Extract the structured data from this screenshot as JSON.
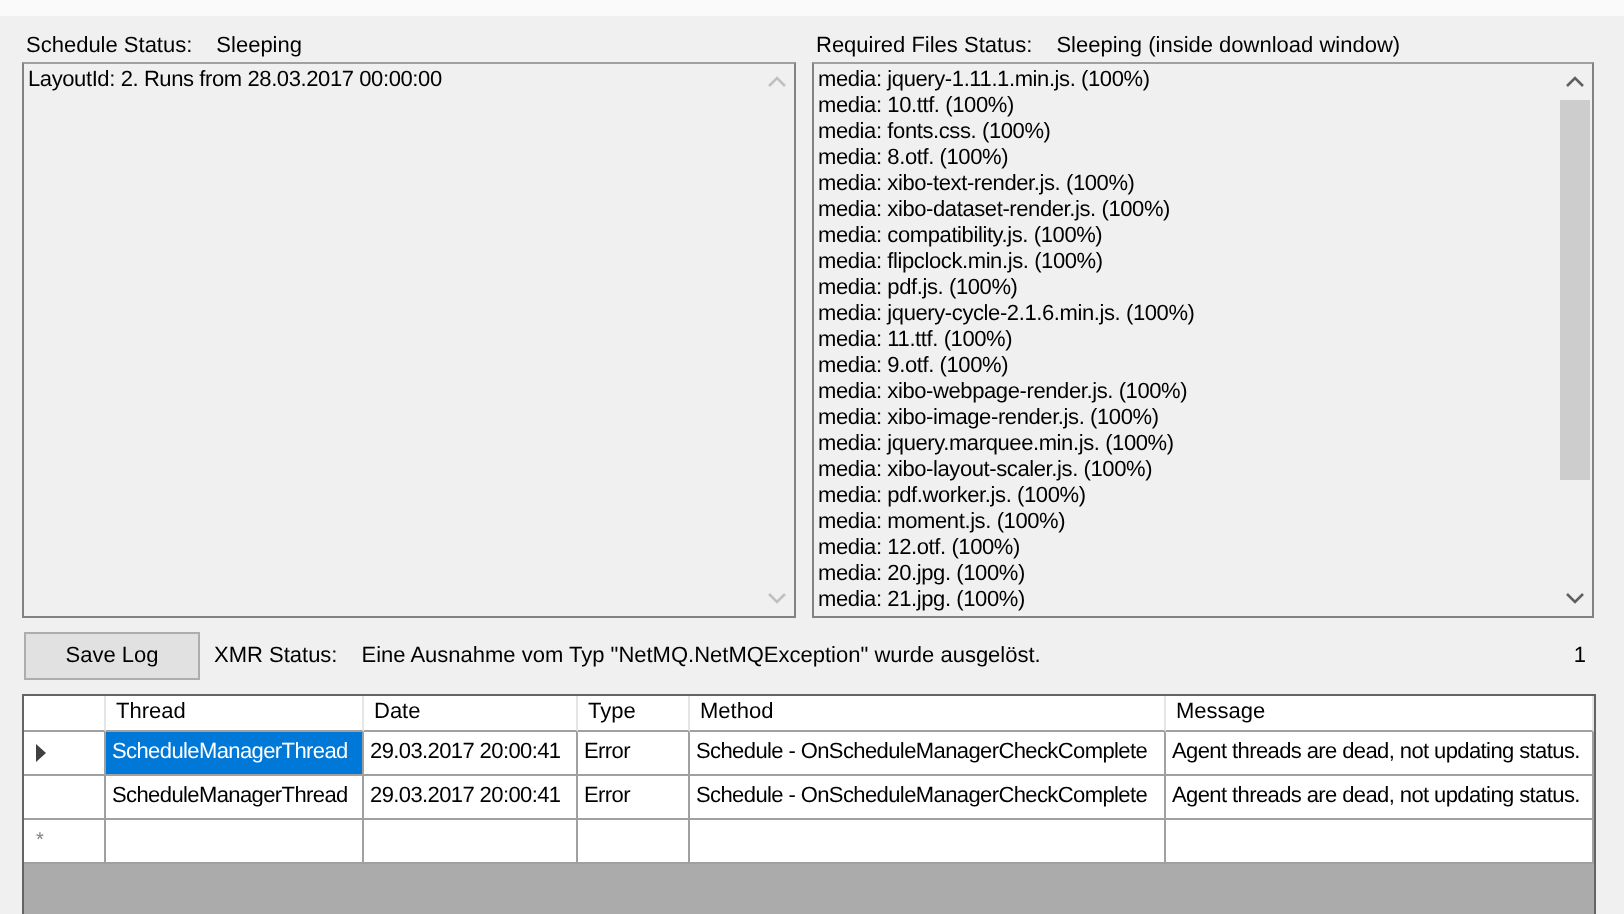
{
  "schedule_status": {
    "label": "Schedule Status:",
    "value": "Sleeping",
    "lines": [
      "LayoutId: 2. Runs from 28.03.2017 00:00:00"
    ]
  },
  "required_files_status": {
    "label": "Required Files Status:",
    "value": "Sleeping (inside download window)",
    "lines": [
      "media: jquery-1.11.1.min.js. (100%)",
      "media: 10.ttf. (100%)",
      "media: fonts.css. (100%)",
      "media: 8.otf. (100%)",
      "media: xibo-text-render.js. (100%)",
      "media: xibo-dataset-render.js. (100%)",
      "media: compatibility.js. (100%)",
      "media: flipclock.min.js. (100%)",
      "media: pdf.js. (100%)",
      "media: jquery-cycle-2.1.6.min.js. (100%)",
      "media: 11.ttf. (100%)",
      "media: 9.otf. (100%)",
      "media: xibo-webpage-render.js. (100%)",
      "media: xibo-image-render.js. (100%)",
      "media: jquery.marquee.min.js. (100%)",
      "media: xibo-layout-scaler.js. (100%)",
      "media: pdf.worker.js. (100%)",
      "media: moment.js. (100%)",
      "media: 12.otf. (100%)",
      "media: 20.jpg. (100%)",
      "media: 21.jpg. (100%)"
    ]
  },
  "save_button": "Save Log",
  "xmr_status": {
    "label": "XMR Status:",
    "value": "Eine Ausnahme vom Typ \"NetMQ.NetMQException\" wurde ausgelöst.",
    "count": "1"
  },
  "log_table": {
    "columns": [
      "Thread",
      "Date",
      "Type",
      "Method",
      "Message"
    ],
    "rows": [
      {
        "selected": true,
        "cells": [
          "ScheduleManagerThread",
          "29.03.2017 20:00:41",
          "Error",
          "Schedule - OnScheduleManagerCheckComplete",
          "Agent threads are dead, not updating status."
        ]
      },
      {
        "selected": false,
        "cells": [
          "ScheduleManagerThread",
          "29.03.2017 20:00:41",
          "Error",
          "Schedule - OnScheduleManagerCheckComplete",
          "Agent threads are dead, not updating status."
        ]
      }
    ],
    "new_row_marker": "*"
  }
}
